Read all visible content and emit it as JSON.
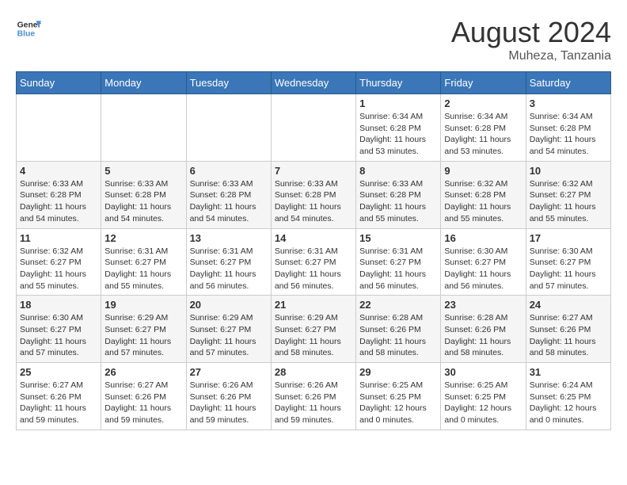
{
  "header": {
    "logo_line1": "General",
    "logo_line2": "Blue",
    "month_year": "August 2024",
    "location": "Muheza, Tanzania"
  },
  "weekdays": [
    "Sunday",
    "Monday",
    "Tuesday",
    "Wednesday",
    "Thursday",
    "Friday",
    "Saturday"
  ],
  "weeks": [
    [
      {
        "day": "",
        "info": ""
      },
      {
        "day": "",
        "info": ""
      },
      {
        "day": "",
        "info": ""
      },
      {
        "day": "",
        "info": ""
      },
      {
        "day": "1",
        "info": "Sunrise: 6:34 AM\nSunset: 6:28 PM\nDaylight: 11 hours\nand 53 minutes."
      },
      {
        "day": "2",
        "info": "Sunrise: 6:34 AM\nSunset: 6:28 PM\nDaylight: 11 hours\nand 53 minutes."
      },
      {
        "day": "3",
        "info": "Sunrise: 6:34 AM\nSunset: 6:28 PM\nDaylight: 11 hours\nand 54 minutes."
      }
    ],
    [
      {
        "day": "4",
        "info": "Sunrise: 6:33 AM\nSunset: 6:28 PM\nDaylight: 11 hours\nand 54 minutes."
      },
      {
        "day": "5",
        "info": "Sunrise: 6:33 AM\nSunset: 6:28 PM\nDaylight: 11 hours\nand 54 minutes."
      },
      {
        "day": "6",
        "info": "Sunrise: 6:33 AM\nSunset: 6:28 PM\nDaylight: 11 hours\nand 54 minutes."
      },
      {
        "day": "7",
        "info": "Sunrise: 6:33 AM\nSunset: 6:28 PM\nDaylight: 11 hours\nand 54 minutes."
      },
      {
        "day": "8",
        "info": "Sunrise: 6:33 AM\nSunset: 6:28 PM\nDaylight: 11 hours\nand 55 minutes."
      },
      {
        "day": "9",
        "info": "Sunrise: 6:32 AM\nSunset: 6:28 PM\nDaylight: 11 hours\nand 55 minutes."
      },
      {
        "day": "10",
        "info": "Sunrise: 6:32 AM\nSunset: 6:27 PM\nDaylight: 11 hours\nand 55 minutes."
      }
    ],
    [
      {
        "day": "11",
        "info": "Sunrise: 6:32 AM\nSunset: 6:27 PM\nDaylight: 11 hours\nand 55 minutes."
      },
      {
        "day": "12",
        "info": "Sunrise: 6:31 AM\nSunset: 6:27 PM\nDaylight: 11 hours\nand 55 minutes."
      },
      {
        "day": "13",
        "info": "Sunrise: 6:31 AM\nSunset: 6:27 PM\nDaylight: 11 hours\nand 56 minutes."
      },
      {
        "day": "14",
        "info": "Sunrise: 6:31 AM\nSunset: 6:27 PM\nDaylight: 11 hours\nand 56 minutes."
      },
      {
        "day": "15",
        "info": "Sunrise: 6:31 AM\nSunset: 6:27 PM\nDaylight: 11 hours\nand 56 minutes."
      },
      {
        "day": "16",
        "info": "Sunrise: 6:30 AM\nSunset: 6:27 PM\nDaylight: 11 hours\nand 56 minutes."
      },
      {
        "day": "17",
        "info": "Sunrise: 6:30 AM\nSunset: 6:27 PM\nDaylight: 11 hours\nand 57 minutes."
      }
    ],
    [
      {
        "day": "18",
        "info": "Sunrise: 6:30 AM\nSunset: 6:27 PM\nDaylight: 11 hours\nand 57 minutes."
      },
      {
        "day": "19",
        "info": "Sunrise: 6:29 AM\nSunset: 6:27 PM\nDaylight: 11 hours\nand 57 minutes."
      },
      {
        "day": "20",
        "info": "Sunrise: 6:29 AM\nSunset: 6:27 PM\nDaylight: 11 hours\nand 57 minutes."
      },
      {
        "day": "21",
        "info": "Sunrise: 6:29 AM\nSunset: 6:27 PM\nDaylight: 11 hours\nand 58 minutes."
      },
      {
        "day": "22",
        "info": "Sunrise: 6:28 AM\nSunset: 6:26 PM\nDaylight: 11 hours\nand 58 minutes."
      },
      {
        "day": "23",
        "info": "Sunrise: 6:28 AM\nSunset: 6:26 PM\nDaylight: 11 hours\nand 58 minutes."
      },
      {
        "day": "24",
        "info": "Sunrise: 6:27 AM\nSunset: 6:26 PM\nDaylight: 11 hours\nand 58 minutes."
      }
    ],
    [
      {
        "day": "25",
        "info": "Sunrise: 6:27 AM\nSunset: 6:26 PM\nDaylight: 11 hours\nand 59 minutes."
      },
      {
        "day": "26",
        "info": "Sunrise: 6:27 AM\nSunset: 6:26 PM\nDaylight: 11 hours\nand 59 minutes."
      },
      {
        "day": "27",
        "info": "Sunrise: 6:26 AM\nSunset: 6:26 PM\nDaylight: 11 hours\nand 59 minutes."
      },
      {
        "day": "28",
        "info": "Sunrise: 6:26 AM\nSunset: 6:26 PM\nDaylight: 11 hours\nand 59 minutes."
      },
      {
        "day": "29",
        "info": "Sunrise: 6:25 AM\nSunset: 6:25 PM\nDaylight: 12 hours\nand 0 minutes."
      },
      {
        "day": "30",
        "info": "Sunrise: 6:25 AM\nSunset: 6:25 PM\nDaylight: 12 hours\nand 0 minutes."
      },
      {
        "day": "31",
        "info": "Sunrise: 6:24 AM\nSunset: 6:25 PM\nDaylight: 12 hours\nand 0 minutes."
      }
    ]
  ]
}
